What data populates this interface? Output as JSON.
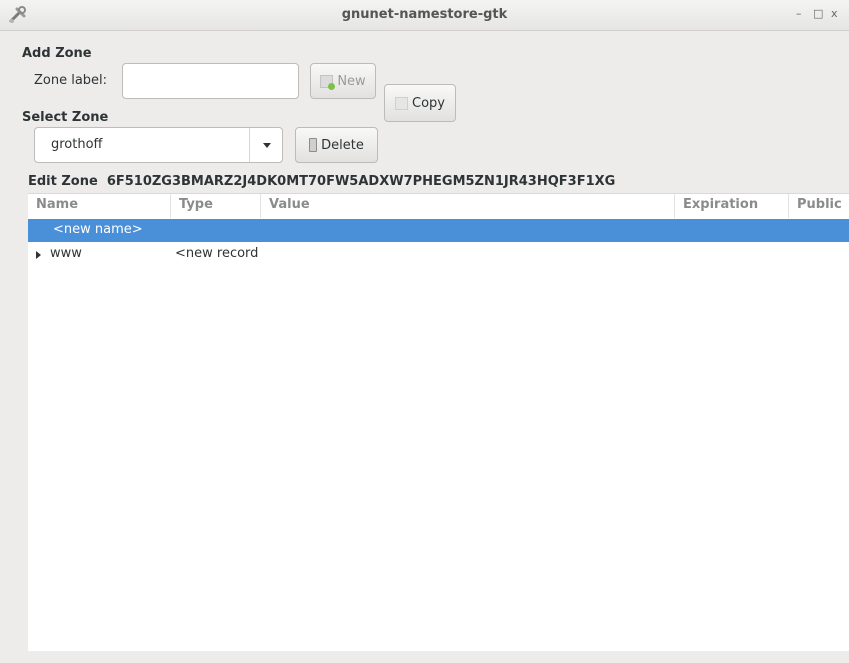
{
  "window": {
    "title": "gnunet-namestore-gtk",
    "controls": {
      "minimize": "–",
      "maximize": "□",
      "close": "x"
    },
    "app_icon": "tools-icon"
  },
  "add_zone": {
    "heading": "Add Zone",
    "zone_label_text": "Zone label:",
    "zone_label_value": "",
    "new_button": "New",
    "copy_button": "Copy"
  },
  "select_zone": {
    "heading": "Select Zone",
    "selected": "grothoff",
    "delete_button": "Delete"
  },
  "edit_zone": {
    "heading": "Edit Zone",
    "zone_key": "6F510ZG3BMARZ2J4DK0MT70FW5ADXW7PHEGM5ZN1JR43HQF3F1XG"
  },
  "tree": {
    "columns": [
      "Name",
      "Type",
      "Value",
      "Expiration",
      "Public"
    ],
    "rows": [
      {
        "name": "<new name>",
        "type": "",
        "value": "",
        "selected": true
      },
      {
        "name": "www",
        "type": "<new record",
        "value": "",
        "expandable": true
      }
    ]
  },
  "colors": {
    "selection": "#4a90d9",
    "window_bg": "#edeceb"
  }
}
